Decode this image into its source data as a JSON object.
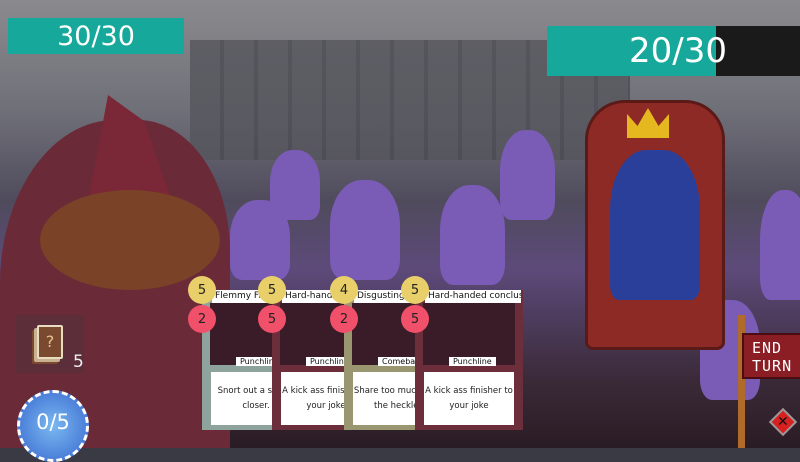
{
  "player": {
    "hp": "30/30",
    "energy": "0/5",
    "deck_count": "5"
  },
  "enemy": {
    "hp": "20/30",
    "hp_fraction": 0.667
  },
  "hand": [
    {
      "title": "Flemmy Fireball",
      "cost": "5",
      "damage": "2",
      "type": "Punchline",
      "text": "Snort out a snotty closer.",
      "color": "#8fa39d"
    },
    {
      "title": "Hard-handed conclusion",
      "cost": "5",
      "damage": "5",
      "type": "Punchline",
      "text": "A kick ass finisher to your joke",
      "color": "#6b2e3a"
    },
    {
      "title": "Disgusting comeback",
      "cost": "4",
      "damage": "2",
      "type": "Comeback",
      "text": "Share too much with the heckler",
      "color": "#9a9670"
    },
    {
      "title": "Hard-handed conclusion...",
      "cost": "5",
      "damage": "5",
      "type": "Punchline",
      "text": "A kick ass finisher to your joke",
      "color": "#6b2e3a"
    }
  ],
  "end_turn": {
    "line1": "END",
    "line2": "TURN"
  },
  "deck_icon_glyph": "?",
  "cancel_glyph": "✕"
}
